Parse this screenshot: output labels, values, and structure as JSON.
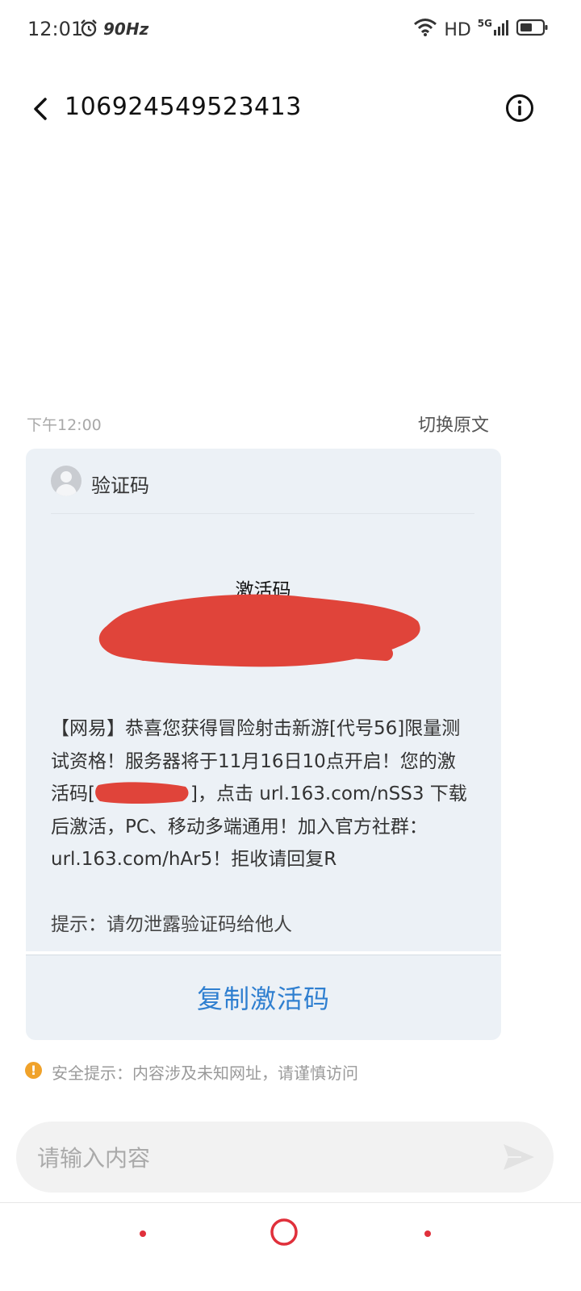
{
  "status_bar": {
    "time": "12:01",
    "refresh_rate": "90Hz",
    "hd_label": "HD",
    "network_label": "5G"
  },
  "header": {
    "title": "106924549523413"
  },
  "message": {
    "time": "下午12:00",
    "switch_original": "切换原文",
    "sender": "验证码",
    "code_label": "激活码",
    "body_part1": "【网易】恭喜您获得冒险射击新游[代号56]限量测试资格！服务器将于11月16日10点开启！您的激活码[",
    "body_part2": "]，点击 url.163.com/nSS3 下载后激活，PC、移动多端通用！加入官方社群：url.163.com/hAr5！拒收请回复R",
    "hint": "提示：请勿泄露验证码给他人",
    "copy_button": "复制激活码"
  },
  "security_warning": "安全提示：内容涉及未知网址，请谨慎访问",
  "input": {
    "placeholder": "请输入内容"
  },
  "colors": {
    "accent": "#2f7fd0",
    "card_bg": "#ecf1f6",
    "warning": "#f0a22a",
    "redaction": "#e0443a",
    "nav_dot": "#e0303b"
  },
  "icons": [
    "back-arrow-icon",
    "info-icon",
    "alarm-icon",
    "wifi-icon",
    "signal-icon",
    "battery-icon",
    "warning-icon",
    "send-icon",
    "home-icon"
  ]
}
